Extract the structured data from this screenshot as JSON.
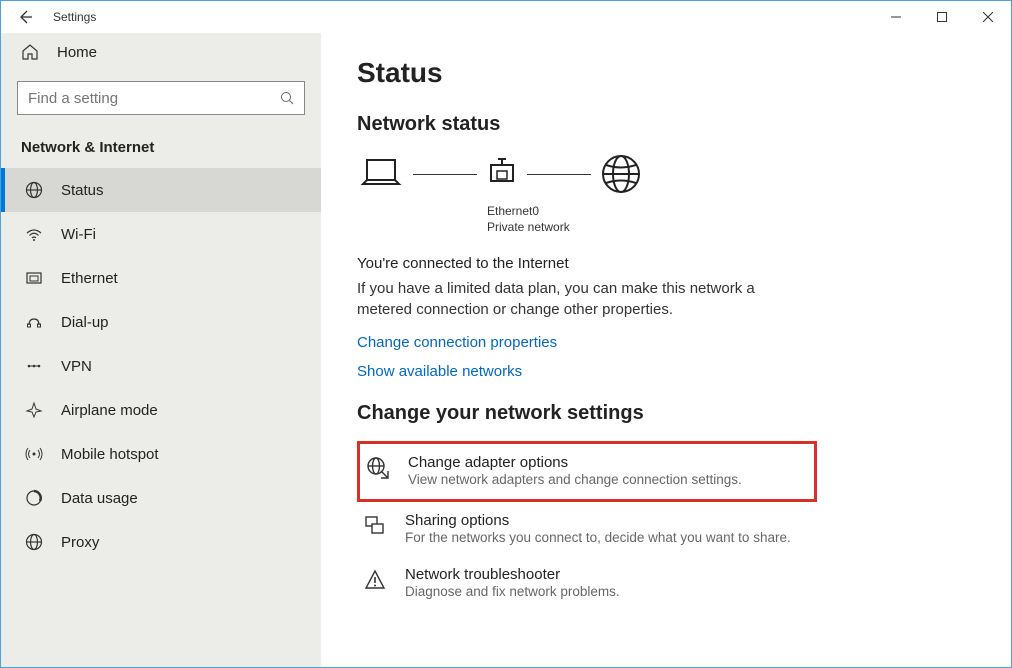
{
  "window": {
    "title": "Settings"
  },
  "sidebar": {
    "home": "Home",
    "search_placeholder": "Find a setting",
    "category": "Network & Internet",
    "items": [
      {
        "label": "Status"
      },
      {
        "label": "Wi-Fi"
      },
      {
        "label": "Ethernet"
      },
      {
        "label": "Dial-up"
      },
      {
        "label": "VPN"
      },
      {
        "label": "Airplane mode"
      },
      {
        "label": "Mobile hotspot"
      },
      {
        "label": "Data usage"
      },
      {
        "label": "Proxy"
      }
    ]
  },
  "content": {
    "heading": "Status",
    "subheading": "Network status",
    "adapter_name": "Ethernet0",
    "network_type": "Private network",
    "connected_title": "You're connected to the Internet",
    "connected_desc": "If you have a limited data plan, you can make this network a metered connection or change other properties.",
    "link_properties": "Change connection properties",
    "link_available": "Show available networks",
    "change_heading": "Change your network settings",
    "options": [
      {
        "title": "Change adapter options",
        "desc": "View network adapters and change connection settings."
      },
      {
        "title": "Sharing options",
        "desc": "For the networks you connect to, decide what you want to share."
      },
      {
        "title": "Network troubleshooter",
        "desc": "Diagnose and fix network problems."
      }
    ]
  }
}
